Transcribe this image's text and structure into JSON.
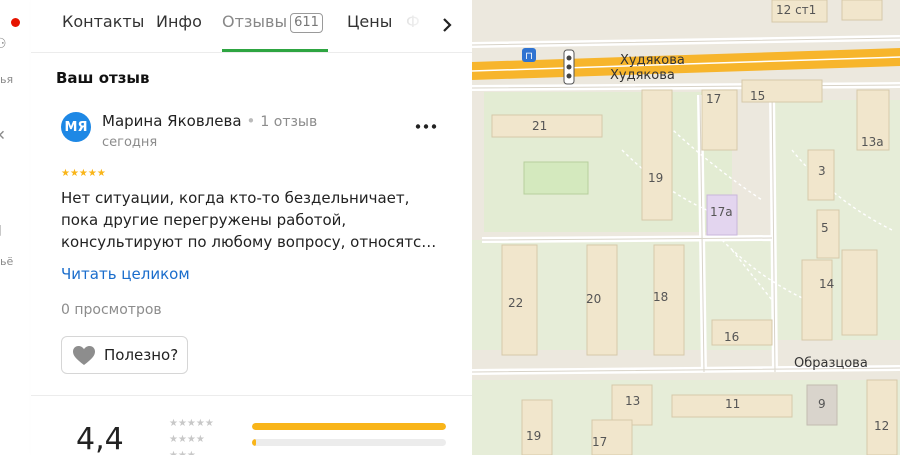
{
  "rail": {
    "captions": [
      "ья",
      "ьё"
    ]
  },
  "tabs": [
    {
      "label": "Контакты"
    },
    {
      "label": "Инфо"
    },
    {
      "label": "Отзывы",
      "count": "611"
    },
    {
      "label": "Цены"
    }
  ],
  "tabs_truncated": "Ф",
  "review_section": {
    "title": "Ваш отзыв",
    "avatar_initials": "МЯ",
    "author": "Марина Яковлева",
    "author_reviews": "1 отзыв",
    "date": "сегодня",
    "rating_value": 5,
    "stars": "★★★★★",
    "text_lines": [
      "Нет ситуации, когда кто-то бездельничает,",
      "пока другие перегружены работой,",
      "консультируют по любому вопросу, относятс…"
    ],
    "read_more": "Читать целиком",
    "views": "0 просмотров",
    "useful_label": "Полезно?"
  },
  "rating_summary": {
    "average": "4,4",
    "distribution": [
      {
        "stars": "★★★★★",
        "fraction": 1.0
      },
      {
        "stars": "★★★★",
        "fraction": 0.02
      },
      {
        "stars": "★★★",
        "fraction": 0.0
      }
    ]
  },
  "map": {
    "streets": [
      "Худякова",
      "Худякова",
      "Образцова"
    ],
    "houses": [
      "12 ст1",
      "17",
      "15",
      "21",
      "13а",
      "19",
      "3",
      "17а",
      "5",
      "22",
      "20",
      "18",
      "14",
      "16",
      "13",
      "11",
      "9",
      "19",
      "17",
      "12"
    ]
  },
  "colors": {
    "accent_green": "#2ea541",
    "link_blue": "#1a6dcc",
    "star_yellow": "#f9b519",
    "avatar_blue": "#1e88e5",
    "road_orange": "#f7b52c"
  }
}
